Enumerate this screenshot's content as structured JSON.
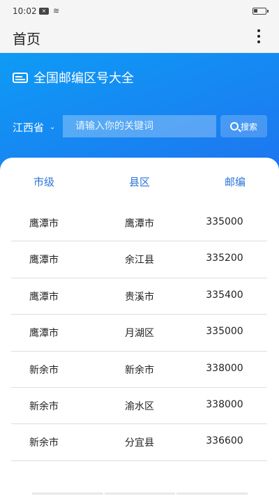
{
  "status_bar": {
    "time": "10:02",
    "sim_icon": "sim-card-icon",
    "wifi_icon": "wifi-icon",
    "battery_icon": "battery-icon",
    "battery_level": 0.3
  },
  "appbar": {
    "title": "首页",
    "menu_icon": "more-vertical-icon"
  },
  "header": {
    "app_icon": "id-card-icon",
    "app_name": "全国邮编区号大全",
    "province": "江西省",
    "search_placeholder": "请输入你的关键词",
    "search_button_label": "搜索"
  },
  "table": {
    "columns": [
      "市级",
      "县区",
      "邮编"
    ],
    "rows": [
      [
        "鹰潭市",
        "鹰潭市",
        "335000"
      ],
      [
        "鹰潭市",
        "余江县",
        "335200"
      ],
      [
        "鹰潭市",
        "贵溪市",
        "335400"
      ],
      [
        "鹰潭市",
        "月湖区",
        "335000"
      ],
      [
        "新余市",
        "新余市",
        "338000"
      ],
      [
        "新余市",
        "渝水区",
        "338000"
      ],
      [
        "新余市",
        "分宜县",
        "336600"
      ]
    ]
  },
  "colors": {
    "header_gradient_start": "#0e9bf5",
    "header_gradient_end": "#1f73ef",
    "column_header": "#2a73d6"
  }
}
